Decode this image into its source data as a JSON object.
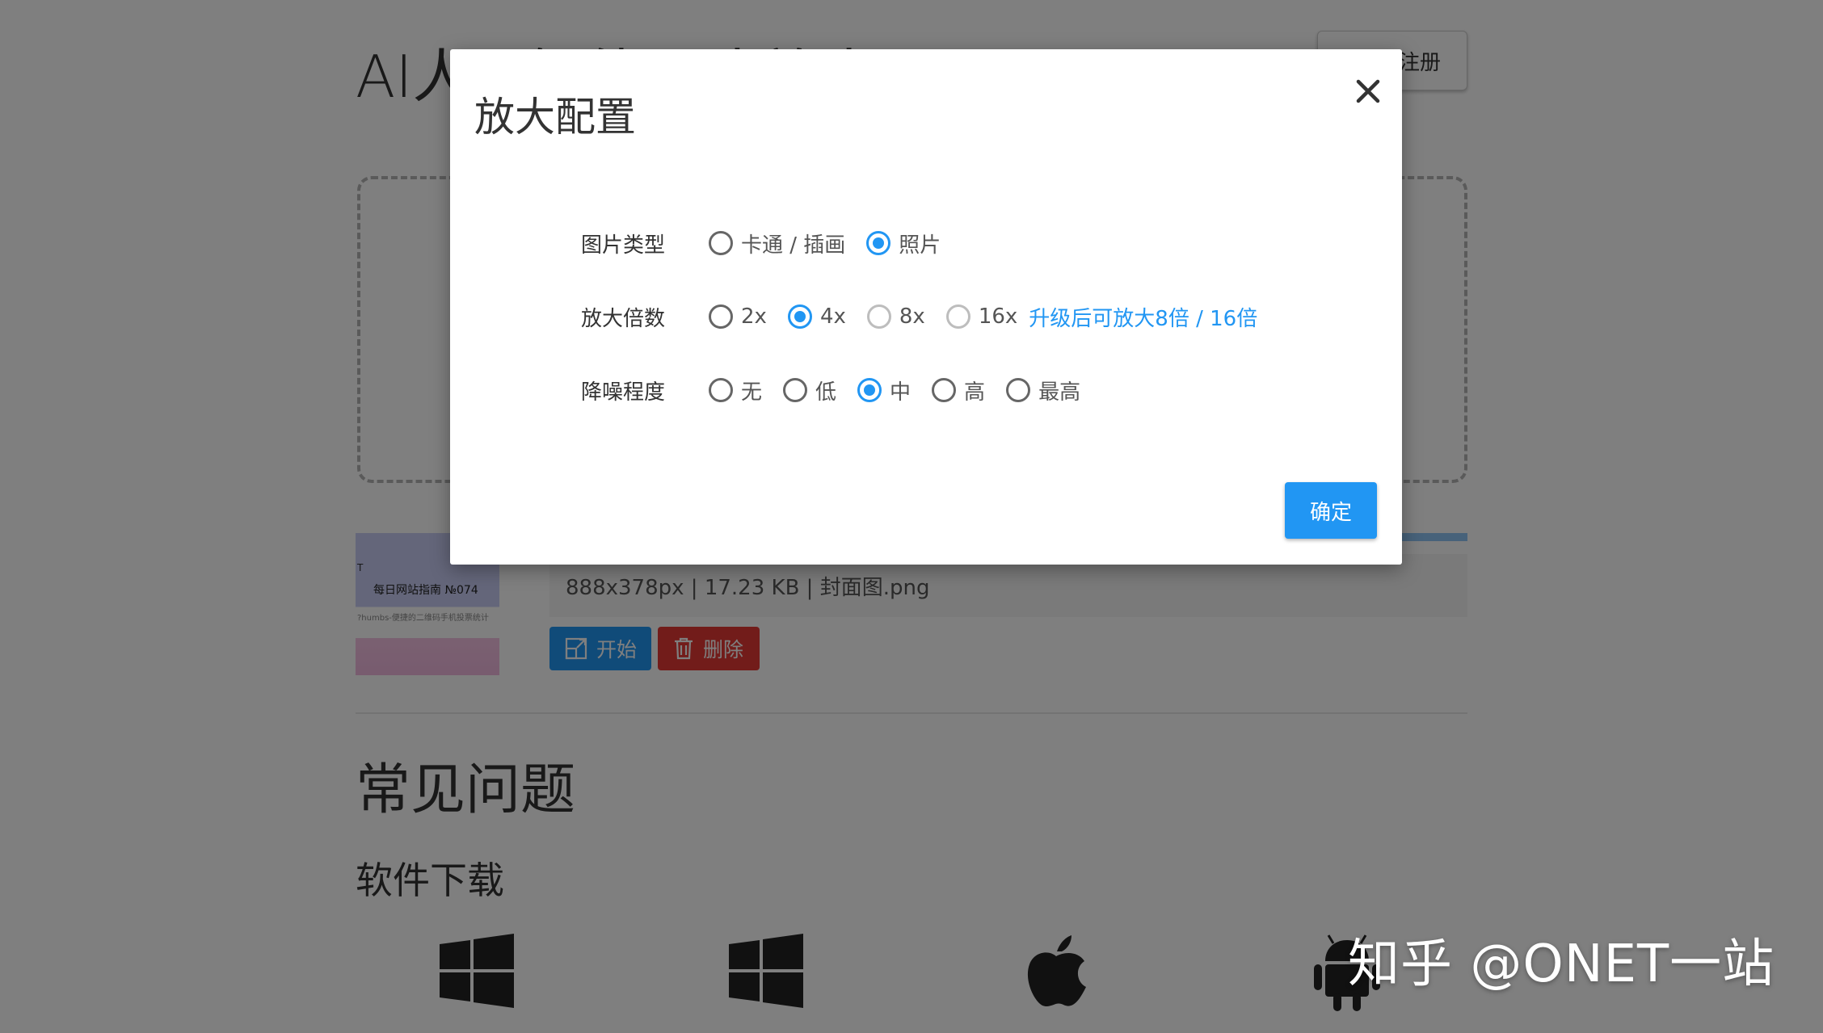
{
  "background": {
    "title": "AI人工智能图片放大",
    "login_button": "注册",
    "thumbnail": {
      "caption": "每日网站指南  №074",
      "subcaption": "?humbs-便捷的二维码手机投票统计",
      "mark": "T"
    },
    "file_info": "888x378px | 17.23 KB | 封面图.png",
    "start_button": "开始",
    "delete_button": "删除",
    "faq_title": "常见问题",
    "download_title": "软件下载"
  },
  "modal": {
    "title": "放大配置",
    "image_type": {
      "label": "图片类型",
      "options": [
        {
          "label": "卡通 / 插画",
          "checked": false
        },
        {
          "label": "照片",
          "checked": true
        }
      ]
    },
    "scale": {
      "label": "放大倍数",
      "options": [
        {
          "label": "2x",
          "checked": false,
          "disabled": false
        },
        {
          "label": "4x",
          "checked": true,
          "disabled": false
        },
        {
          "label": "8x",
          "checked": false,
          "disabled": true
        },
        {
          "label": "16x",
          "checked": false,
          "disabled": true
        }
      ],
      "upgrade_link": "升级后可放大8倍 / 16倍"
    },
    "denoise": {
      "label": "降噪程度",
      "options": [
        {
          "label": "无",
          "checked": false
        },
        {
          "label": "低",
          "checked": false
        },
        {
          "label": "中",
          "checked": true
        },
        {
          "label": "高",
          "checked": false
        },
        {
          "label": "最高",
          "checked": false
        }
      ]
    },
    "confirm_button": "确定"
  },
  "watermark": "知乎 @ONET一站",
  "colors": {
    "accent": "#2196f3",
    "danger": "#e53935",
    "overlay": "rgba(0,0,0,0.5)"
  }
}
